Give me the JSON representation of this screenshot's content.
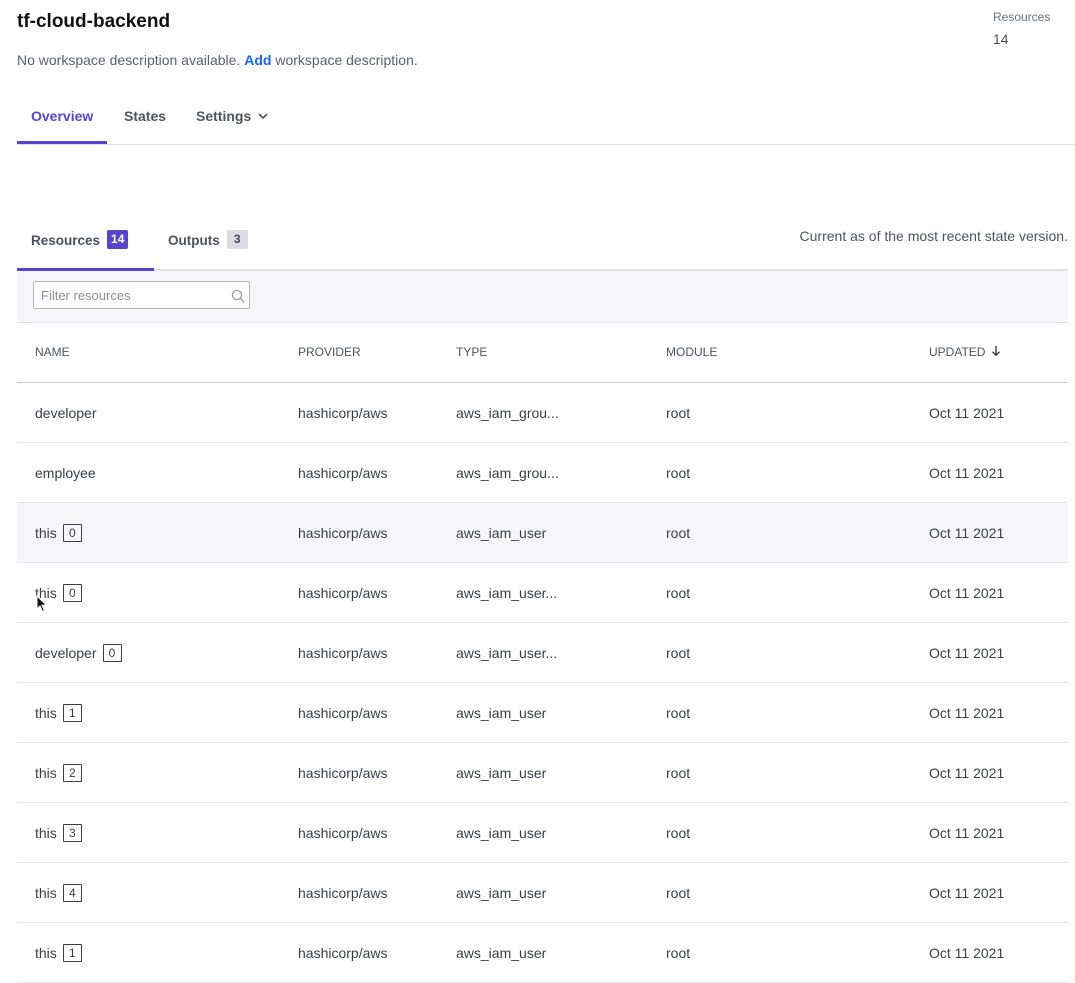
{
  "workspace": {
    "title": "tf-cloud-backend",
    "desc_before": "No workspace description available. ",
    "desc_link": "Add",
    "desc_after": " workspace description.",
    "meta_label": "Resources",
    "meta_value": "14"
  },
  "main_tabs": [
    "Overview",
    "States",
    "Settings"
  ],
  "sub_tabs": {
    "resources_label": "Resources",
    "resources_count": "14",
    "outputs_label": "Outputs",
    "outputs_count": "3"
  },
  "current_note": "Current as of the most recent state version.",
  "filter": {
    "placeholder": "Filter resources"
  },
  "columns": [
    "NAME",
    "PROVIDER",
    "TYPE",
    "MODULE",
    "UPDATED"
  ],
  "rows": [
    {
      "name": "developer",
      "index": "",
      "provider": "hashicorp/aws",
      "type": "aws_iam_grou...",
      "module": "root",
      "updated": "Oct 11 2021"
    },
    {
      "name": "employee",
      "index": "",
      "provider": "hashicorp/aws",
      "type": "aws_iam_grou...",
      "module": "root",
      "updated": "Oct 11 2021"
    },
    {
      "name": "this",
      "index": "0",
      "provider": "hashicorp/aws",
      "type": "aws_iam_user",
      "module": "root",
      "updated": "Oct 11 2021"
    },
    {
      "name": "this",
      "index": "0",
      "provider": "hashicorp/aws",
      "type": "aws_iam_user...",
      "module": "root",
      "updated": "Oct 11 2021"
    },
    {
      "name": "developer",
      "index": "0",
      "provider": "hashicorp/aws",
      "type": "aws_iam_user...",
      "module": "root",
      "updated": "Oct 11 2021"
    },
    {
      "name": "this",
      "index": "1",
      "provider": "hashicorp/aws",
      "type": "aws_iam_user",
      "module": "root",
      "updated": "Oct 11 2021"
    },
    {
      "name": "this",
      "index": "2",
      "provider": "hashicorp/aws",
      "type": "aws_iam_user",
      "module": "root",
      "updated": "Oct 11 2021"
    },
    {
      "name": "this",
      "index": "3",
      "provider": "hashicorp/aws",
      "type": "aws_iam_user",
      "module": "root",
      "updated": "Oct 11 2021"
    },
    {
      "name": "this",
      "index": "4",
      "provider": "hashicorp/aws",
      "type": "aws_iam_user",
      "module": "root",
      "updated": "Oct 11 2021"
    },
    {
      "name": "this",
      "index": "1",
      "provider": "hashicorp/aws",
      "type": "aws_iam_user",
      "module": "root",
      "updated": "Oct 11 2021"
    }
  ],
  "colors": {
    "accent": "#5a43cc",
    "link": "#1563ff",
    "row_hover": "#f6f6f9"
  }
}
